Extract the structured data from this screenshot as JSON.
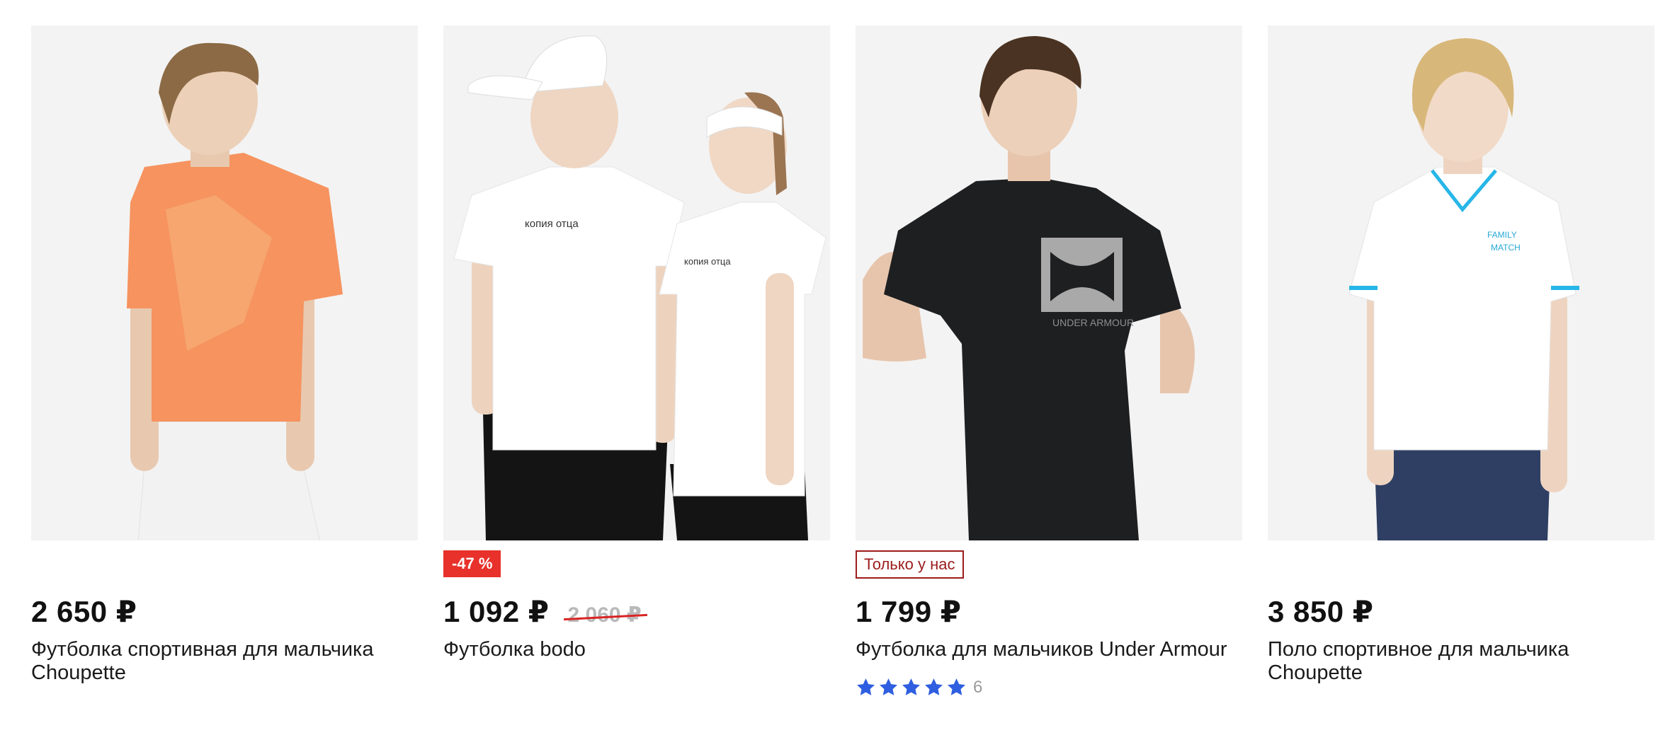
{
  "currency": "₽",
  "products": [
    {
      "price": "2 650 ₽",
      "old_price": "",
      "badge": "",
      "title": "Футболка спортивная для мальчика Choupette",
      "image_alt": "Мальчик в оранжевой спортивной футболке и белых шортах",
      "shirt_color": "#f6935f",
      "print_text": ""
    },
    {
      "price": "1 092 ₽",
      "old_price": "2 060 ₽",
      "badge": "-47 %",
      "title": "Футболка bodo",
      "image_alt": "Мальчик и девочка в белых футболках",
      "shirt_color": "#ffffff",
      "print_text": "копия отца"
    },
    {
      "price": "1 799 ₽",
      "old_price": "",
      "badge": "Только у нас",
      "title": "Футболка для мальчиков Under Armour",
      "image_alt": "Мальчик в чёрной футболке Under Armour",
      "shirt_color": "#1e1f21",
      "print_text": "UNDER ARMOUR",
      "rating": {
        "stars": 5,
        "count": "6",
        "star_color": "#2f5fe0"
      }
    },
    {
      "price": "3 850 ₽",
      "old_price": "",
      "badge": "",
      "title": "Поло спортивное для мальчика Choupette",
      "image_alt": "Мальчик в белом поло и синих шортах",
      "shirt_color": "#ffffff",
      "print_text": ""
    }
  ],
  "colors": {
    "discount_badge": "#e8312a",
    "exclusive_badge": "#9c1c1c",
    "old_price_strike": "#d82424",
    "card_bg": "#f3f3f3"
  }
}
